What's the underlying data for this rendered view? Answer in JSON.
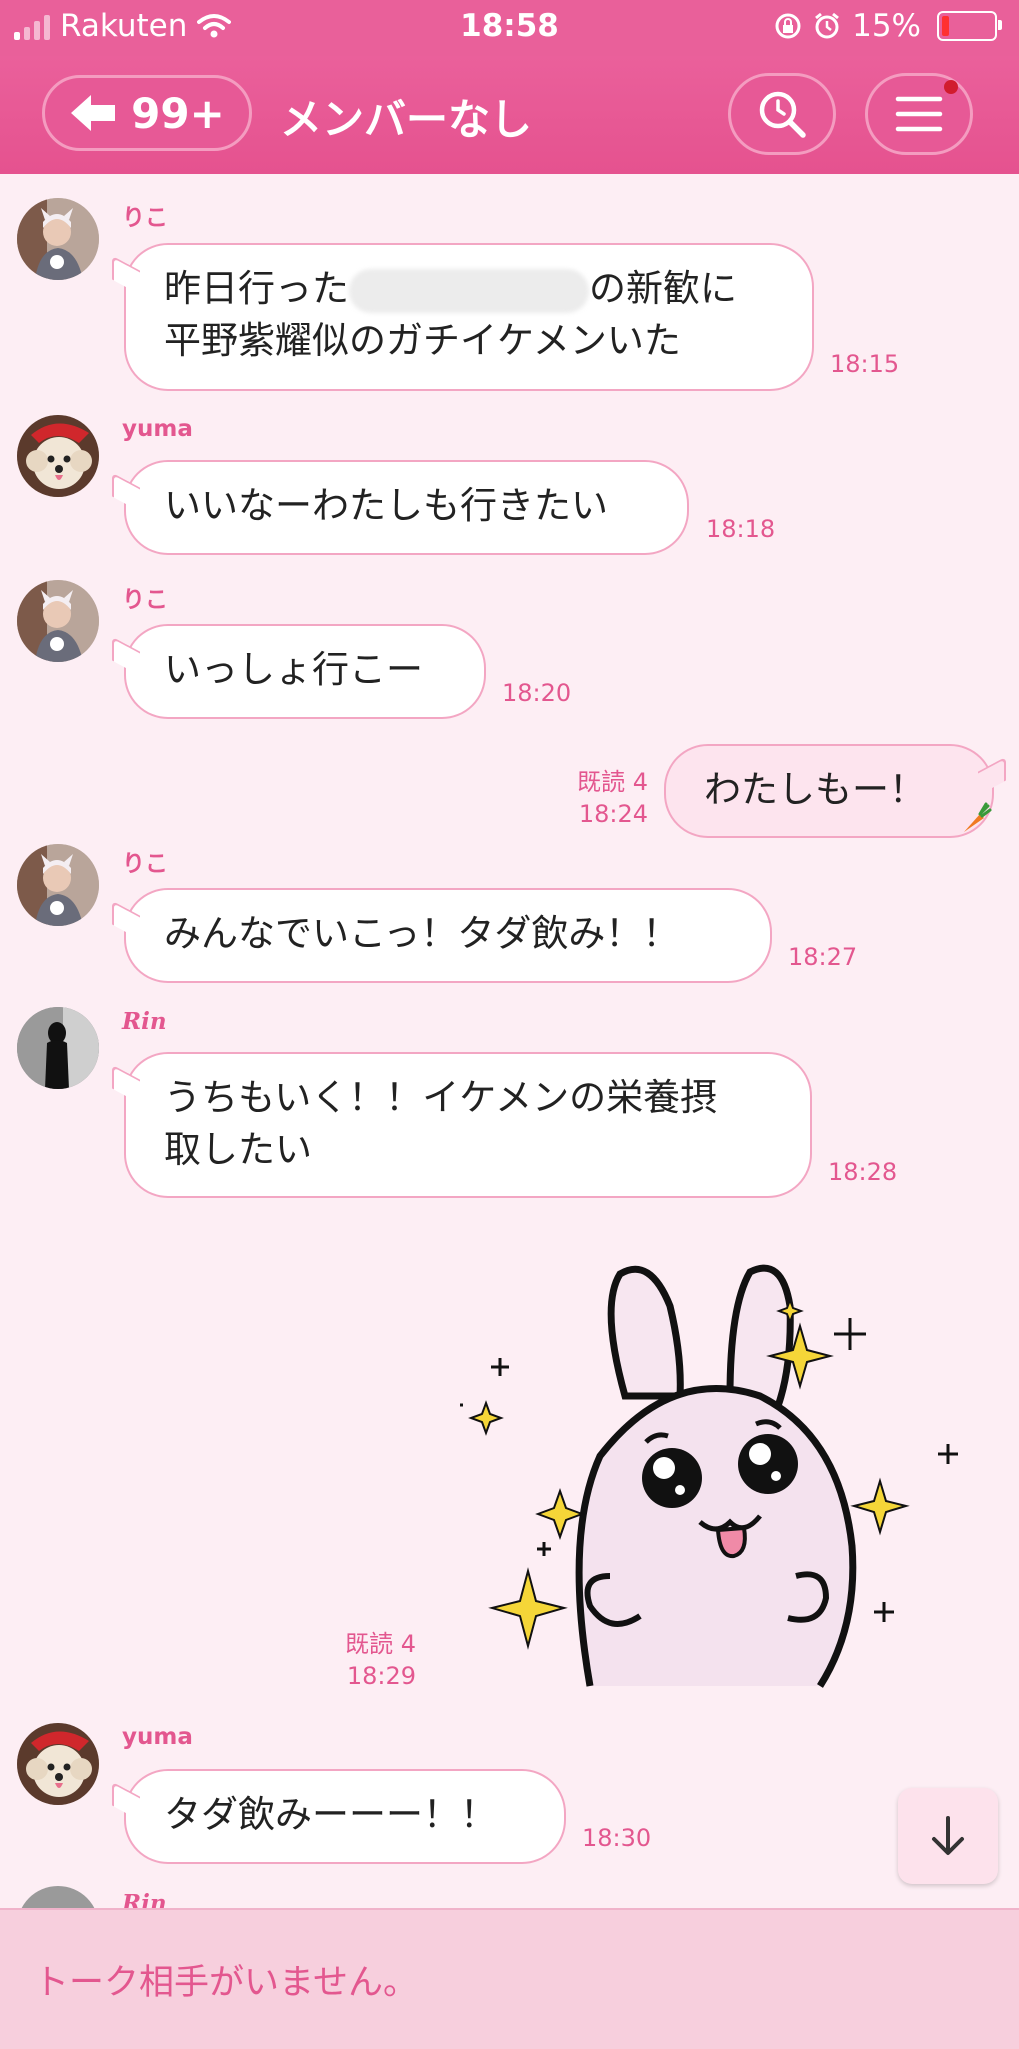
{
  "status_bar": {
    "carrier": "Rakuten",
    "time": "18:58",
    "battery": "15%"
  },
  "header": {
    "back_count": "99+",
    "title": "メンバーなし"
  },
  "messages": [
    {
      "sender": "りこ",
      "lines": [
        "昨日行った",
        "の新歓に",
        "平野紫耀似のガチイケメンいた"
      ],
      "time": "18:15"
    },
    {
      "sender": "yuma",
      "text": "いいなーわたしも行きたい",
      "time": "18:18"
    },
    {
      "sender": "りこ",
      "text": "いっしょ行こー",
      "time": "18:20"
    },
    {
      "read": "既読 4",
      "text": "わたしもー！",
      "time": "18:24"
    },
    {
      "sender": "りこ",
      "text": "みんなでいこっ！タダ飲み！！",
      "time": "18:27"
    },
    {
      "sender": "Rin",
      "lines": [
        "うちもいく！！イケメンの栄養摂",
        "取したい"
      ],
      "time": "18:28"
    },
    {
      "read": "既読 4",
      "sticker": "bunny-sparkle-sticker",
      "time": "18:29"
    },
    {
      "sender": "yuma",
      "text": "タダ飲みーーー！！",
      "time": "18:30"
    },
    {
      "sender": "Rin"
    }
  ],
  "footer": {
    "placeholder": "トーク相手がいません。"
  },
  "colors": {
    "header": "#e5528f",
    "background": "#fdeef4",
    "accent": "#e3578f",
    "bubble_border": "#f3a6c3",
    "footer": "#f7cfdd"
  }
}
